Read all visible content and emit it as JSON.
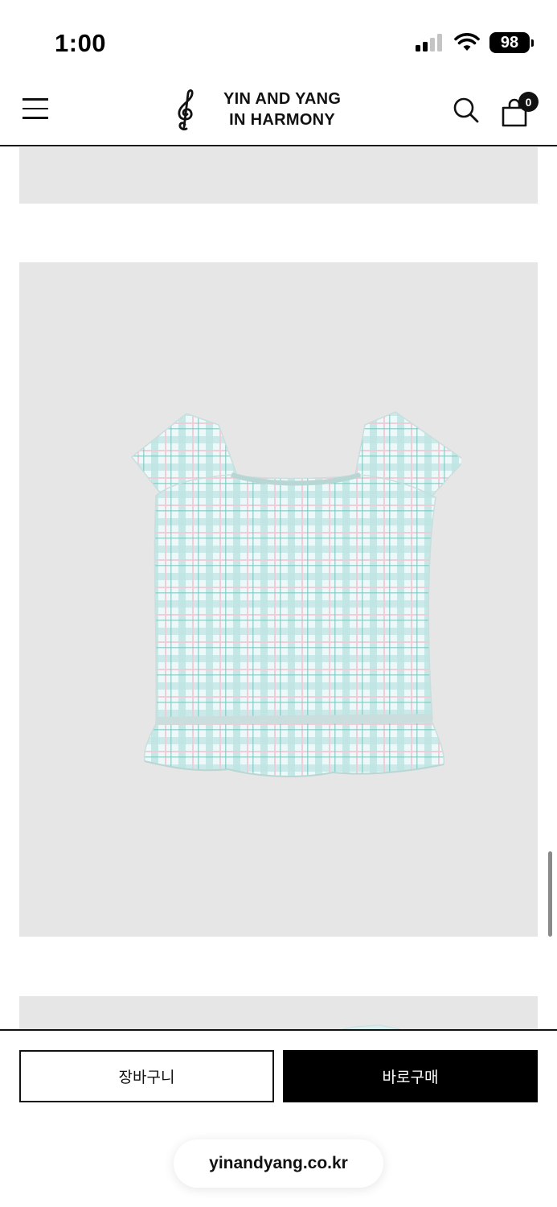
{
  "status_bar": {
    "time": "1:00",
    "battery": "98",
    "icons": [
      "cellular-signal-icon",
      "wifi-icon",
      "battery-icon"
    ]
  },
  "header": {
    "brand_line1": "YIN AND YANG",
    "brand_line2": "IN HARMONY",
    "cart_count": "0",
    "icons": [
      "hamburger-menu-icon",
      "treble-clef-logo",
      "search-icon",
      "shopping-bag-icon"
    ]
  },
  "product": {
    "image_background": "#e6e6e6"
  },
  "actions": {
    "add_to_cart": "장바구니",
    "buy_now": "바로구매"
  },
  "browser": {
    "url": "yinandyang.co.kr"
  },
  "colors": {
    "primary": "#000000",
    "background": "#ffffff",
    "image_panel": "#e6e6e6",
    "garment_mint": "#bfe4e2"
  }
}
